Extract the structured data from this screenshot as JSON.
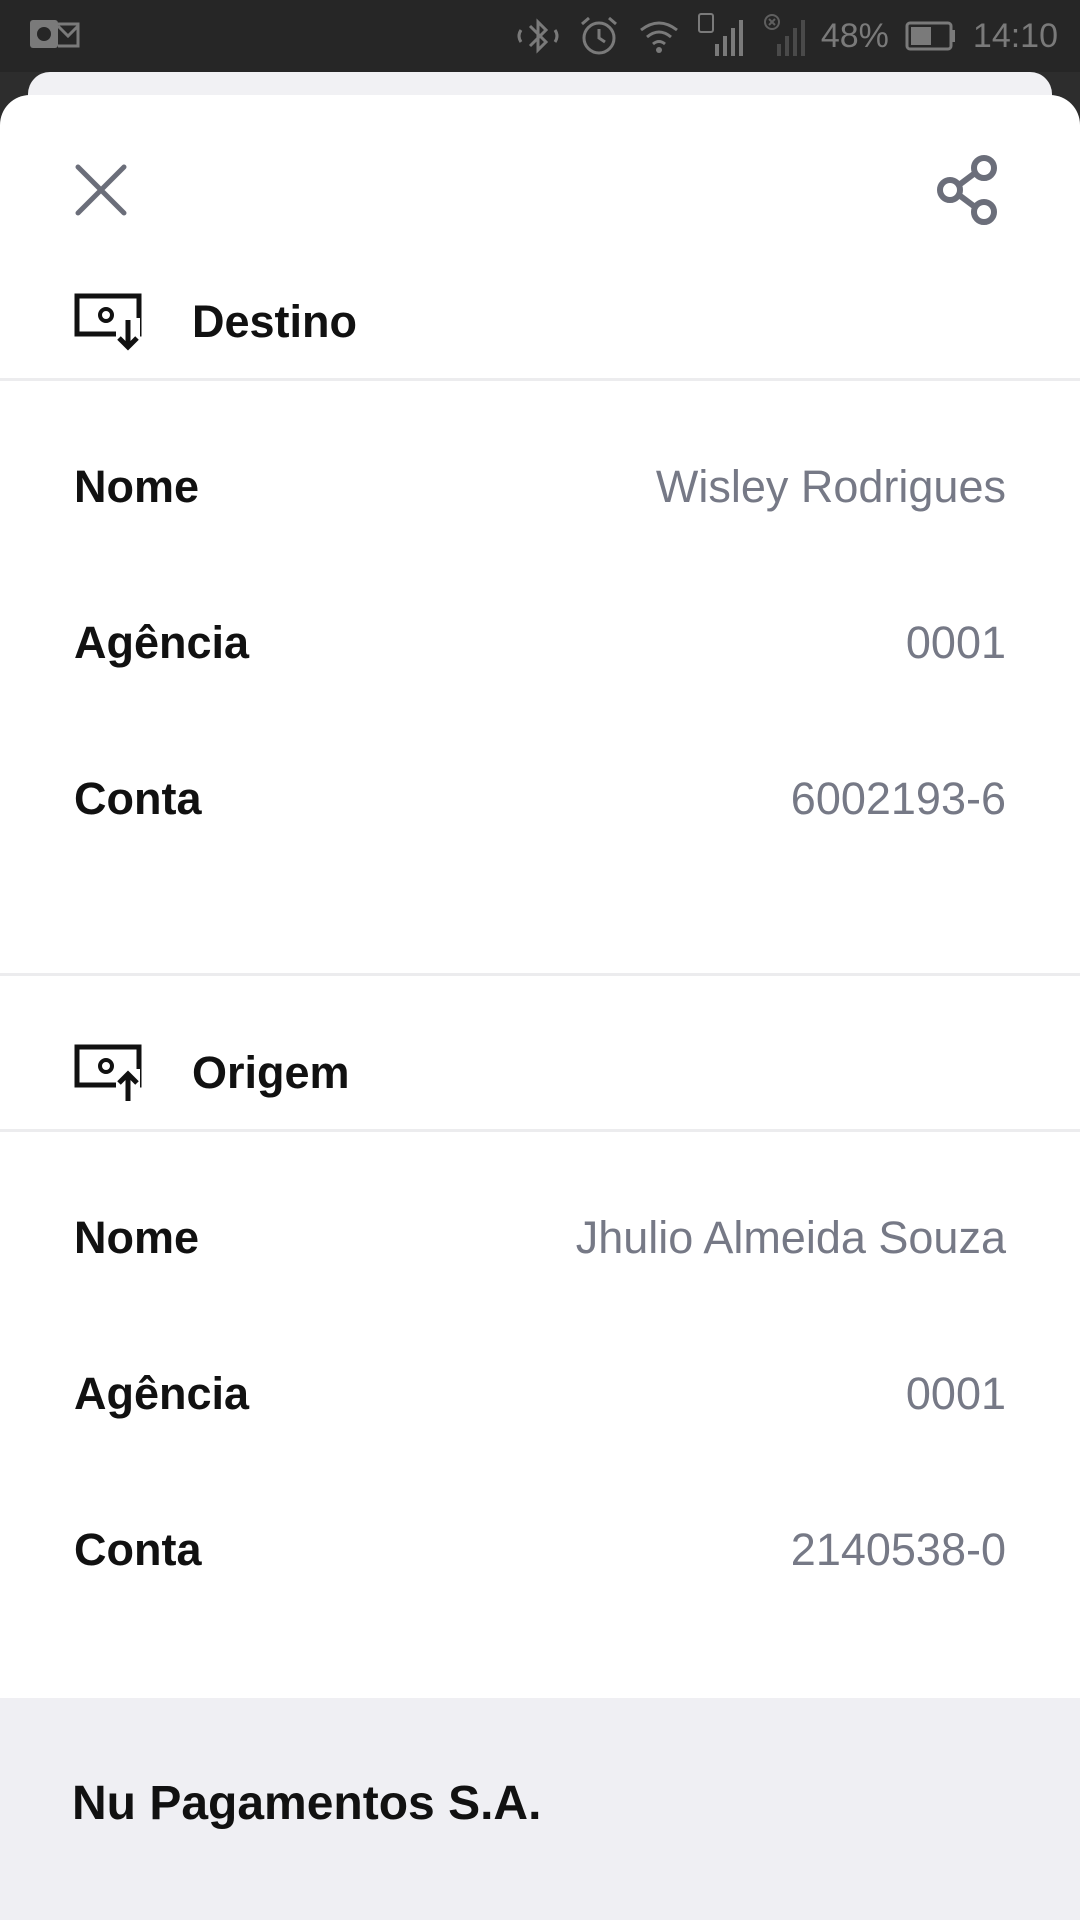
{
  "status_bar": {
    "battery_percent": "48%",
    "time": "14:10",
    "sim_slot": "1",
    "icons": [
      "outlook-icon",
      "bluetooth-icon",
      "alarm-icon",
      "wifi-icon",
      "signal-icon",
      "no-signal-icon",
      "battery-icon"
    ]
  },
  "header": {
    "close_icon": "close-icon",
    "share_icon": "share-icon"
  },
  "destination": {
    "title": "Destino",
    "icon": "money-receive-icon",
    "rows": [
      {
        "label": "Nome",
        "value": "Wisley Rodrigues"
      },
      {
        "label": "Agência",
        "value": "0001"
      },
      {
        "label": "Conta",
        "value": "6002193-6"
      }
    ]
  },
  "origin": {
    "title": "Origem",
    "icon": "money-send-icon",
    "rows": [
      {
        "label": "Nome",
        "value": "Jhulio Almeida Souza"
      },
      {
        "label": "Agência",
        "value": "0001"
      },
      {
        "label": "Conta",
        "value": "2140538-0"
      }
    ]
  },
  "footer": {
    "company": "Nu Pagamentos S.A."
  },
  "colors": {
    "label": "#111111",
    "value": "#767986",
    "divider": "#ececee",
    "footer_bg": "#efeff3",
    "statusbar_bg": "#262626"
  }
}
